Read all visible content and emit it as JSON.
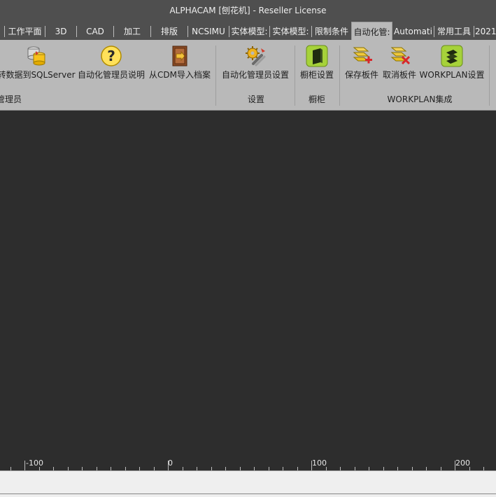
{
  "window": {
    "title": "ALPHACAM [刨花机] - Reseller License"
  },
  "tabs": [
    {
      "label": ""
    },
    {
      "label": "工作平面"
    },
    {
      "label": "3D"
    },
    {
      "label": "CAD"
    },
    {
      "label": "加工"
    },
    {
      "label": "排版"
    },
    {
      "label": "NCSIMU"
    },
    {
      "label": "实体模型:"
    },
    {
      "label": "实体模型:"
    },
    {
      "label": "限制条件"
    },
    {
      "label": "自动化管:"
    },
    {
      "label": "Automati"
    },
    {
      "label": "常用工具"
    },
    {
      "label": "2021"
    }
  ],
  "ribbon": {
    "buttons": {
      "sqlserver": {
        "label": "转数据到SQLServer",
        "icon": "database-icon"
      },
      "manager_help": {
        "label": "自动化管理员说明",
        "icon": "help-icon"
      },
      "cdm_import": {
        "label": "从CDM导入档案",
        "icon": "door-import-icon"
      },
      "manager_settings": {
        "label": "自动化管理员设置",
        "icon": "gear-tools-icon"
      },
      "cabinet_settings": {
        "label": "橱柜设置",
        "icon": "cabinet-icon"
      },
      "save_board": {
        "label": "保存板件",
        "icon": "add-board-icon"
      },
      "cancel_board": {
        "label": "取消板件",
        "icon": "remove-board-icon"
      },
      "workplan_settings": {
        "label": "WORKPLAN设置",
        "icon": "workplan-icon"
      }
    },
    "groups": {
      "manager": {
        "label": "管理员"
      },
      "settings": {
        "label": "设置"
      },
      "cabinet": {
        "label": "橱柜"
      },
      "workplan": {
        "label": "WORKPLAN集成"
      }
    }
  },
  "ruler": {
    "labels": [
      "-100",
      "0",
      "100",
      "200"
    ]
  },
  "colors": {
    "ribbon_bg": "#b9b9b9",
    "titlebar_bg": "#4f4f4f",
    "canvas_bg": "#2d2d2d"
  }
}
